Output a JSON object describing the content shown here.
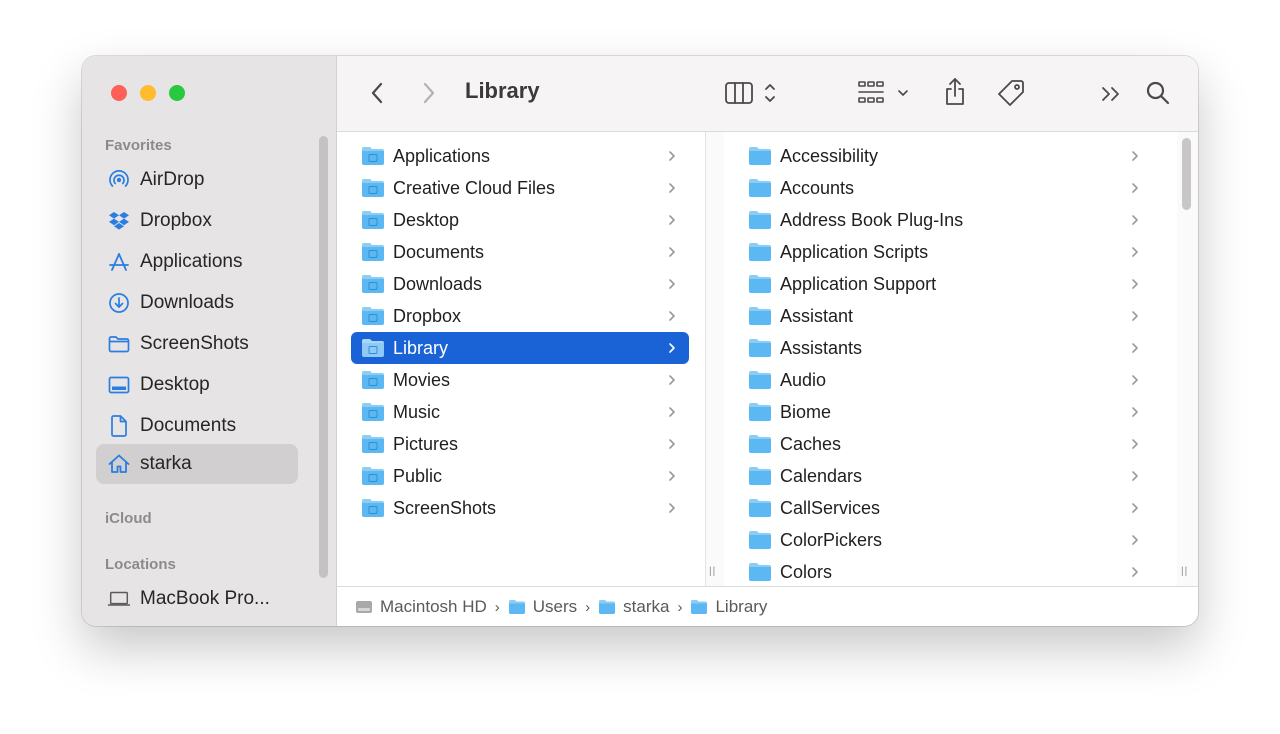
{
  "window_title": "Library",
  "sidebar": {
    "favorites_header": "Favorites",
    "icloud_header": "iCloud",
    "locations_header": "Locations",
    "items": [
      {
        "label": "AirDrop",
        "icon": "airdrop-icon"
      },
      {
        "label": "Dropbox",
        "icon": "dropbox-icon"
      },
      {
        "label": "Applications",
        "icon": "applications-icon"
      },
      {
        "label": "Downloads",
        "icon": "downloads-icon"
      },
      {
        "label": "ScreenShots",
        "icon": "folder-icon"
      },
      {
        "label": "Desktop",
        "icon": "desktop-icon"
      },
      {
        "label": "Documents",
        "icon": "document-icon"
      },
      {
        "label": "starka",
        "icon": "home-icon",
        "selected": true
      }
    ],
    "locations": [
      {
        "label": "MacBook Pro...",
        "icon": "laptop-icon"
      }
    ]
  },
  "column1": [
    {
      "label": "Applications"
    },
    {
      "label": "Creative Cloud Files"
    },
    {
      "label": "Desktop"
    },
    {
      "label": "Documents"
    },
    {
      "label": "Downloads"
    },
    {
      "label": "Dropbox"
    },
    {
      "label": "Library",
      "selected": true
    },
    {
      "label": "Movies"
    },
    {
      "label": "Music"
    },
    {
      "label": "Pictures"
    },
    {
      "label": "Public"
    },
    {
      "label": "ScreenShots"
    }
  ],
  "column2": [
    {
      "label": "Accessibility"
    },
    {
      "label": "Accounts"
    },
    {
      "label": "Address Book Plug-Ins"
    },
    {
      "label": "Application Scripts"
    },
    {
      "label": "Application Support"
    },
    {
      "label": "Assistant"
    },
    {
      "label": "Assistants"
    },
    {
      "label": "Audio"
    },
    {
      "label": "Biome"
    },
    {
      "label": "Caches"
    },
    {
      "label": "Calendars"
    },
    {
      "label": "CallServices"
    },
    {
      "label": "ColorPickers"
    },
    {
      "label": "Colors"
    }
  ],
  "pathbar": [
    {
      "label": "Macintosh HD",
      "icon": "disk-icon"
    },
    {
      "label": "Users",
      "icon": "folder-icon"
    },
    {
      "label": "starka",
      "icon": "home-folder-icon"
    },
    {
      "label": "Library",
      "icon": "folder-icon"
    }
  ],
  "colors": {
    "accent": "#1a63d6",
    "sidebar_icon": "#2a7de1",
    "folder": "#5cb8f2"
  }
}
